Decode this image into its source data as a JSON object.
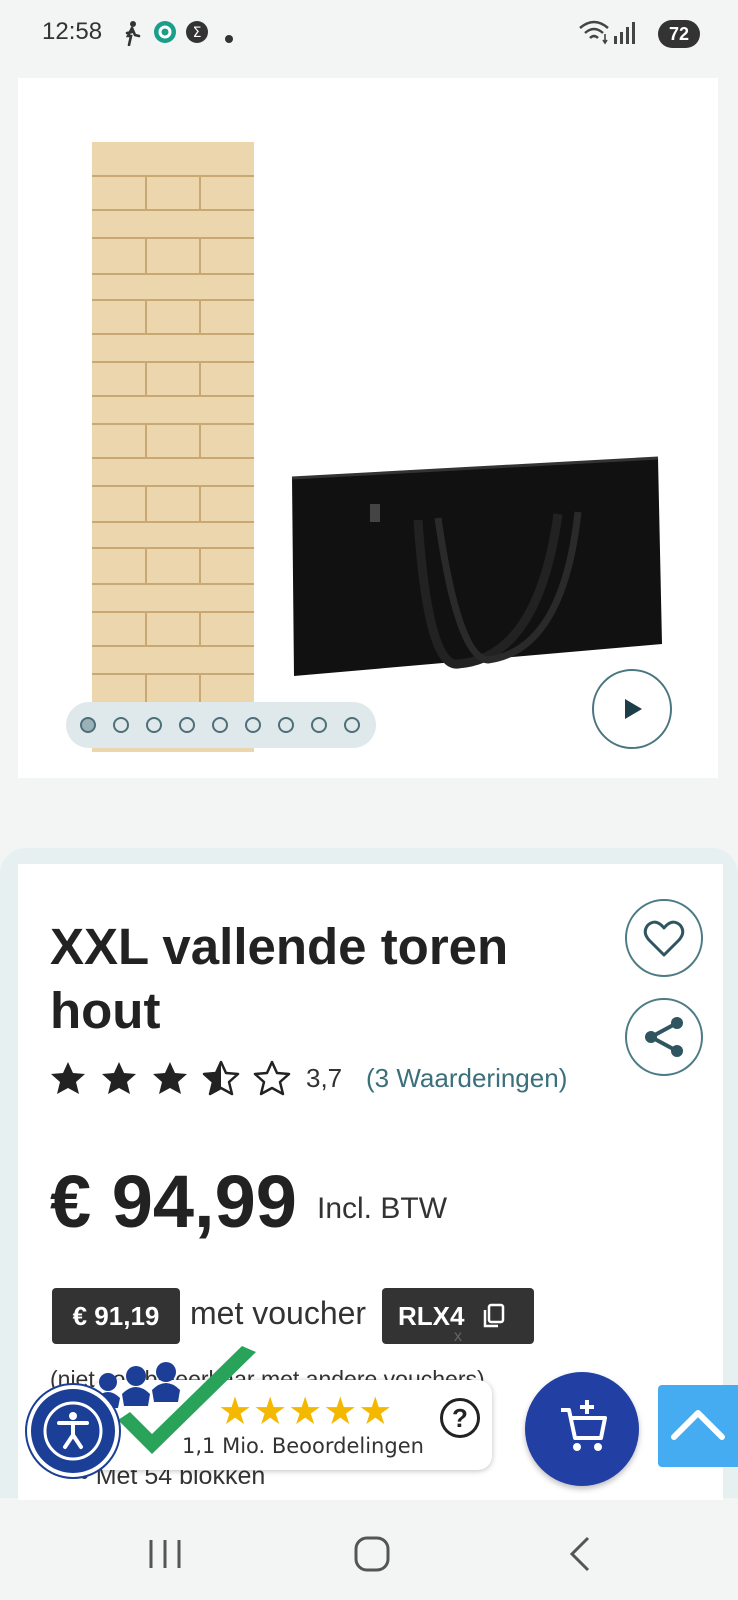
{
  "status_bar": {
    "time": "12:58",
    "battery": "72"
  },
  "gallery": {
    "dot_count": 9,
    "active_dot": 0
  },
  "product": {
    "title": "XXL vallende toren hout",
    "rating": {
      "stars": 3.7,
      "value": "3,7",
      "reviews": "(3 Waarderingen)"
    },
    "price": "€ 94,99",
    "vat_label": "Incl. BTW",
    "voucher": {
      "price": "€ 91,19",
      "text": "met voucher",
      "code": "RLX4",
      "note": "(niet combineerbaar met andere vouchers)"
    },
    "bullet": "Met 54 blokken"
  },
  "trust_badge": {
    "stars": "★★★★★",
    "text": "1,1 Mio. Beoordelingen",
    "help": "?",
    "close": "x"
  },
  "colors": {
    "accent": "#3a6f7b",
    "fab": "#223fa3",
    "scroll_top": "#45acf1",
    "star": "#f5b800"
  }
}
